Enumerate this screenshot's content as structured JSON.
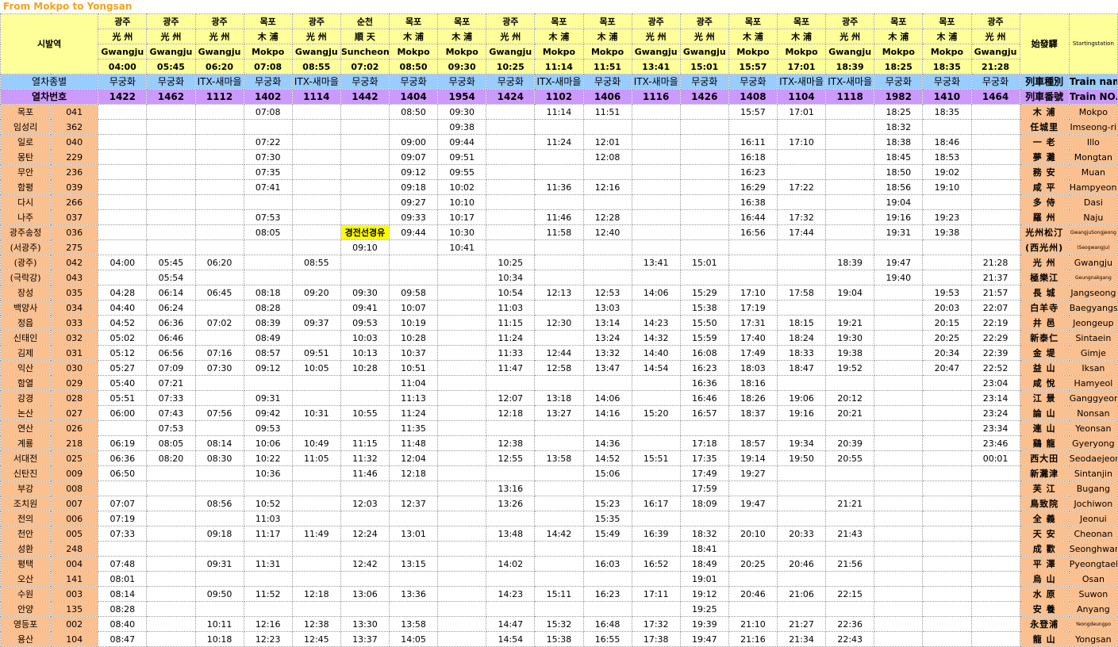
{
  "title": "From Mokpo to Yongsan",
  "header": {
    "origin_label": "시발역",
    "type_label": "열차종별",
    "number_label": "열차번호",
    "right_origin_hanja": "始發驛",
    "right_origin_en": "Startingstation",
    "right_type_hanja": "列車種別",
    "right_type_en": "Train name",
    "right_number_hanja": "列車番號",
    "right_number_en": "Train NO."
  },
  "trains": [
    {
      "ko": "광주",
      "hanja": "光 州",
      "en": "Gwangju",
      "time": "04:00",
      "type": "무궁화",
      "no": "1422"
    },
    {
      "ko": "광주",
      "hanja": "光 州",
      "en": "Gwangju",
      "time": "05:45",
      "type": "무궁화",
      "no": "1462"
    },
    {
      "ko": "광주",
      "hanja": "光 州",
      "en": "Gwangju",
      "time": "06:20",
      "type": "ITX-새마을",
      "no": "1112"
    },
    {
      "ko": "목포",
      "hanja": "木 浦",
      "en": "Mokpo",
      "time": "07:08",
      "type": "무궁화",
      "no": "1402"
    },
    {
      "ko": "광주",
      "hanja": "光 州",
      "en": "Gwangju",
      "time": "08:55",
      "type": "ITX-새마을",
      "no": "1114"
    },
    {
      "ko": "순천",
      "hanja": "順 天",
      "en": "Suncheon",
      "time": "07:02",
      "type": "무궁화",
      "no": "1442"
    },
    {
      "ko": "목포",
      "hanja": "木 浦",
      "en": "Mokpo",
      "time": "08:50",
      "type": "무궁화",
      "no": "1404"
    },
    {
      "ko": "목포",
      "hanja": "木 浦",
      "en": "Mokpo",
      "time": "09:30",
      "type": "무궁화",
      "no": "1954"
    },
    {
      "ko": "광주",
      "hanja": "光 州",
      "en": "Gwangju",
      "time": "10:25",
      "type": "무궁화",
      "no": "1424"
    },
    {
      "ko": "목포",
      "hanja": "木 浦",
      "en": "Mokpo",
      "time": "11:14",
      "type": "ITX-새마을",
      "no": "1102"
    },
    {
      "ko": "목포",
      "hanja": "木 浦",
      "en": "Mokpo",
      "time": "11:51",
      "type": "무궁화",
      "no": "1406"
    },
    {
      "ko": "광주",
      "hanja": "光 州",
      "en": "Gwangju",
      "time": "13:41",
      "type": "ITX-새마을",
      "no": "1116"
    },
    {
      "ko": "광주",
      "hanja": "光 州",
      "en": "Gwangju",
      "time": "15:01",
      "type": "무궁화",
      "no": "1426"
    },
    {
      "ko": "목포",
      "hanja": "木 浦",
      "en": "Mokpo",
      "time": "15:57",
      "type": "무궁화",
      "no": "1408"
    },
    {
      "ko": "목포",
      "hanja": "木 浦",
      "en": "Mokpo",
      "time": "17:01",
      "type": "ITX-새마을",
      "no": "1104"
    },
    {
      "ko": "광주",
      "hanja": "光 州",
      "en": "Gwangju",
      "time": "18:39",
      "type": "ITX-새마을",
      "no": "1118"
    },
    {
      "ko": "목포",
      "hanja": "木 浦",
      "en": "Mokpo",
      "time": "18:25",
      "type": "무궁화",
      "no": "1982"
    },
    {
      "ko": "목포",
      "hanja": "木 浦",
      "en": "Mokpo",
      "time": "18:35",
      "type": "무궁화",
      "no": "1410"
    },
    {
      "ko": "광주",
      "hanja": "光 州",
      "en": "Gwangju",
      "time": "21:28",
      "type": "무궁화",
      "no": "1464"
    }
  ],
  "stations": [
    {
      "ko": "목포",
      "code": "041",
      "hanja": "木 浦",
      "en": "Mokpo",
      "times": [
        "",
        "",
        "",
        "07:08",
        "",
        "",
        "08:50",
        "09:30",
        "",
        "11:14",
        "11:51",
        "",
        "",
        "15:57",
        "17:01",
        "",
        "18:25",
        "18:35",
        ""
      ]
    },
    {
      "ko": "임성리",
      "code": "362",
      "hanja": "任城里",
      "en": "Imseong-ri",
      "times": [
        "",
        "",
        "",
        "",
        "",
        "",
        "",
        "09:38",
        "",
        "",
        "",
        "",
        "",
        "",
        "",
        "",
        "18:32",
        "",
        ""
      ]
    },
    {
      "ko": "일로",
      "code": "040",
      "hanja": "一 老",
      "en": "Illo",
      "times": [
        "",
        "",
        "",
        "07:22",
        "",
        "",
        "09:00",
        "09:44",
        "",
        "11:24",
        "12:01",
        "",
        "",
        "16:11",
        "17:10",
        "",
        "18:38",
        "18:46",
        ""
      ]
    },
    {
      "ko": "몽탄",
      "code": "229",
      "hanja": "夢 灘",
      "en": "Mongtan",
      "times": [
        "",
        "",
        "",
        "07:30",
        "",
        "",
        "09:07",
        "09:51",
        "",
        "",
        "12:08",
        "",
        "",
        "16:18",
        "",
        "",
        "18:45",
        "18:53",
        ""
      ]
    },
    {
      "ko": "무안",
      "code": "236",
      "hanja": "務 安",
      "en": "Muan",
      "times": [
        "",
        "",
        "",
        "07:35",
        "",
        "",
        "09:12",
        "09:55",
        "",
        "",
        "",
        "",
        "",
        "16:23",
        "",
        "",
        "18:50",
        "19:02",
        ""
      ]
    },
    {
      "ko": "함평",
      "code": "039",
      "hanja": "咸 平",
      "en": "Hampyeong",
      "times": [
        "",
        "",
        "",
        "07:41",
        "",
        "",
        "09:18",
        "10:02",
        "",
        "11:36",
        "12:16",
        "",
        "",
        "16:29",
        "17:22",
        "",
        "18:56",
        "19:10",
        ""
      ]
    },
    {
      "ko": "다시",
      "code": "266",
      "hanja": "多 侍",
      "en": "Dasi",
      "times": [
        "",
        "",
        "",
        "",
        "",
        "",
        "09:27",
        "10:10",
        "",
        "",
        "",
        "",
        "",
        "16:38",
        "",
        "",
        "19:04",
        "",
        ""
      ]
    },
    {
      "ko": "나주",
      "code": "037",
      "hanja": "羅 州",
      "en": "Naju",
      "times": [
        "",
        "",
        "",
        "07:53",
        "",
        "",
        "09:33",
        "10:17",
        "",
        "11:46",
        "12:28",
        "",
        "",
        "16:44",
        "17:32",
        "",
        "19:16",
        "19:23",
        ""
      ]
    },
    {
      "ko": "광주송정",
      "code": "036",
      "hanja": "光州松汀",
      "en": "GwangjuSongjeong",
      "small": true,
      "times": [
        "",
        "",
        "",
        "08:05",
        "",
        "경전선경유",
        "09:44",
        "10:30",
        "",
        "11:58",
        "12:40",
        "",
        "",
        "16:56",
        "17:44",
        "",
        "19:31",
        "19:38",
        ""
      ]
    },
    {
      "ko": "(서광주)",
      "code": "275",
      "hanja": "(西光州)",
      "en": "(Seogwangju)",
      "small": true,
      "times": [
        "",
        "",
        "",
        "",
        "",
        "09:10",
        "",
        "10:41",
        "",
        "",
        "",
        "",
        "",
        "",
        "",
        "",
        "",
        "",
        ""
      ]
    },
    {
      "ko": "(광주)",
      "code": "042",
      "hanja": "光 州",
      "en": "Gwangju",
      "times": [
        "04:00",
        "05:45",
        "06:20",
        "",
        "08:55",
        "",
        "",
        "",
        "10:25",
        "",
        "",
        "13:41",
        "15:01",
        "",
        "",
        "18:39",
        "19:47",
        "",
        "21:28"
      ]
    },
    {
      "ko": "(극락강)",
      "code": "043",
      "hanja": "極樂江",
      "en": "Geungnakgang",
      "small": true,
      "times": [
        "",
        "05:54",
        "",
        "",
        "",
        "",
        "",
        "",
        "10:34",
        "",
        "",
        "",
        "",
        "",
        "",
        "",
        "19:40",
        "",
        "21:37"
      ]
    },
    {
      "ko": "장성",
      "code": "035",
      "hanja": "長 城",
      "en": "Jangseong",
      "times": [
        "04:28",
        "06:14",
        "06:45",
        "08:18",
        "09:20",
        "09:30",
        "09:58",
        "",
        "10:54",
        "12:13",
        "12:53",
        "14:06",
        "15:29",
        "17:10",
        "17:58",
        "19:04",
        "",
        "19:53",
        "21:57"
      ]
    },
    {
      "ko": "백양사",
      "code": "034",
      "hanja": "白羊寺",
      "en": "Baegyangsa",
      "times": [
        "04:40",
        "06:24",
        "",
        "08:28",
        "",
        "09:41",
        "10:07",
        "",
        "11:03",
        "",
        "13:03",
        "",
        "15:38",
        "17:19",
        "",
        "",
        "",
        "20:03",
        "22:07"
      ]
    },
    {
      "ko": "정읍",
      "code": "033",
      "hanja": "井 邑",
      "en": "Jeongeup",
      "times": [
        "04:52",
        "06:36",
        "07:02",
        "08:39",
        "09:37",
        "09:53",
        "10:19",
        "",
        "11:15",
        "12:30",
        "13:14",
        "14:23",
        "15:50",
        "17:31",
        "18:15",
        "19:21",
        "",
        "20:15",
        "22:19"
      ]
    },
    {
      "ko": "신태인",
      "code": "032",
      "hanja": "新泰仁",
      "en": "Sintaein",
      "times": [
        "05:02",
        "06:46",
        "",
        "08:49",
        "",
        "10:03",
        "10:28",
        "",
        "11:24",
        "",
        "13:24",
        "14:32",
        "15:59",
        "17:40",
        "18:24",
        "19:30",
        "",
        "20:25",
        "22:29"
      ]
    },
    {
      "ko": "김제",
      "code": "031",
      "hanja": "金 堤",
      "en": "Gimje",
      "times": [
        "05:12",
        "06:56",
        "07:16",
        "08:57",
        "09:51",
        "10:13",
        "10:37",
        "",
        "11:33",
        "12:44",
        "13:32",
        "14:40",
        "16:08",
        "17:49",
        "18:33",
        "19:38",
        "",
        "20:34",
        "22:39"
      ]
    },
    {
      "ko": "익산",
      "code": "030",
      "hanja": "益 山",
      "en": "Iksan",
      "times": [
        "05:27",
        "07:09",
        "07:30",
        "09:12",
        "10:05",
        "10:28",
        "10:51",
        "",
        "11:47",
        "12:58",
        "13:47",
        "14:54",
        "16:23",
        "18:03",
        "18:47",
        "19:52",
        "",
        "20:47",
        "22:52"
      ]
    },
    {
      "ko": "함열",
      "code": "029",
      "hanja": "咸 悅",
      "en": "Hamyeol",
      "times": [
        "05:40",
        "07:21",
        "",
        "",
        "",
        "",
        "11:04",
        "",
        "",
        "",
        "",
        "",
        "16:36",
        "18:16",
        "",
        "",
        "",
        "",
        "23:04"
      ]
    },
    {
      "ko": "강경",
      "code": "028",
      "hanja": "江 景",
      "en": "Ganggyeong",
      "times": [
        "05:51",
        "07:33",
        "",
        "09:31",
        "",
        "",
        "11:13",
        "",
        "12:07",
        "13:18",
        "14:06",
        "",
        "16:46",
        "18:26",
        "19:06",
        "20:12",
        "",
        "",
        "23:14"
      ]
    },
    {
      "ko": "논산",
      "code": "027",
      "hanja": "論 山",
      "en": "Nonsan",
      "times": [
        "06:00",
        "07:43",
        "07:56",
        "09:42",
        "10:31",
        "10:55",
        "11:24",
        "",
        "12:18",
        "13:27",
        "14:16",
        "15:20",
        "16:57",
        "18:37",
        "19:16",
        "20:21",
        "",
        "",
        "23:24"
      ]
    },
    {
      "ko": "연산",
      "code": "026",
      "hanja": "連 山",
      "en": "Yeonsan",
      "times": [
        "",
        "07:53",
        "",
        "09:53",
        "",
        "",
        "11:35",
        "",
        "",
        "",
        "",
        "",
        "",
        "",
        "",
        "",
        "",
        "",
        "23:34"
      ]
    },
    {
      "ko": "계룡",
      "code": "218",
      "hanja": "鷄 龍",
      "en": "Gyeryong",
      "times": [
        "06:19",
        "08:05",
        "08:14",
        "10:06",
        "10:49",
        "11:15",
        "11:48",
        "",
        "12:38",
        "",
        "14:36",
        "",
        "17:18",
        "18:57",
        "19:34",
        "20:39",
        "",
        "",
        "23:46"
      ]
    },
    {
      "ko": "서대전",
      "code": "025",
      "hanja": "西大田",
      "en": "Seodaejeon",
      "times": [
        "06:36",
        "08:20",
        "08:30",
        "10:22",
        "11:05",
        "11:32",
        "12:04",
        "",
        "12:55",
        "13:58",
        "14:52",
        "15:51",
        "17:35",
        "19:14",
        "19:50",
        "20:55",
        "",
        "",
        "00:01"
      ]
    },
    {
      "ko": "신탄진",
      "code": "009",
      "hanja": "新灘津",
      "en": "Sintanjin",
      "times": [
        "06:50",
        "",
        "",
        "10:36",
        "",
        "11:46",
        "12:18",
        "",
        "",
        "",
        "15:06",
        "",
        "17:49",
        "19:27",
        "",
        "",
        "",
        "",
        ""
      ]
    },
    {
      "ko": "부강",
      "code": "008",
      "hanja": "芙 江",
      "en": "Bugang",
      "times": [
        "",
        "",
        "",
        "",
        "",
        "",
        "",
        "",
        "13:16",
        "",
        "",
        "",
        "17:59",
        "",
        "",
        "",
        "",
        "",
        ""
      ]
    },
    {
      "ko": "조치원",
      "code": "007",
      "hanja": "鳥致院",
      "en": "Jochiwon",
      "times": [
        "07:07",
        "",
        "08:56",
        "10:52",
        "",
        "12:03",
        "12:37",
        "",
        "13:26",
        "",
        "15:23",
        "16:17",
        "18:09",
        "19:47",
        "",
        "21:21",
        "",
        "",
        ""
      ]
    },
    {
      "ko": "전의",
      "code": "006",
      "hanja": "全 義",
      "en": "Jeonui",
      "times": [
        "07:19",
        "",
        "",
        "11:03",
        "",
        "",
        "",
        "",
        "",
        "",
        "15:35",
        "",
        "",
        "",
        "",
        "",
        "",
        "",
        ""
      ]
    },
    {
      "ko": "천안",
      "code": "005",
      "hanja": "天 安",
      "en": "Cheonan",
      "times": [
        "07:33",
        "",
        "09:18",
        "11:17",
        "11:49",
        "12:24",
        "13:01",
        "",
        "13:48",
        "14:42",
        "15:49",
        "16:39",
        "18:32",
        "20:10",
        "20:33",
        "21:43",
        "",
        "",
        ""
      ]
    },
    {
      "ko": "성환",
      "code": "248",
      "hanja": "成 歡",
      "en": "Seonghwan",
      "times": [
        "",
        "",
        "",
        "",
        "",
        "",
        "",
        "",
        "",
        "",
        "",
        "",
        "18:41",
        "",
        "",
        "",
        "",
        "",
        ""
      ]
    },
    {
      "ko": "평택",
      "code": "004",
      "hanja": "平 澤",
      "en": "Pyeongtaek",
      "times": [
        "07:48",
        "",
        "09:31",
        "11:31",
        "",
        "12:42",
        "13:15",
        "",
        "14:02",
        "",
        "16:03",
        "16:52",
        "18:49",
        "20:25",
        "20:46",
        "21:56",
        "",
        "",
        ""
      ]
    },
    {
      "ko": "오산",
      "code": "141",
      "hanja": "烏 山",
      "en": "Osan",
      "times": [
        "08:01",
        "",
        "",
        "",
        "",
        "",
        "",
        "",
        "",
        "",
        "",
        "",
        "19:01",
        "",
        "",
        "",
        "",
        "",
        ""
      ]
    },
    {
      "ko": "수원",
      "code": "003",
      "hanja": "水 原",
      "en": "Suwon",
      "times": [
        "08:14",
        "",
        "09:50",
        "11:52",
        "12:18",
        "13:06",
        "13:36",
        "",
        "14:23",
        "15:11",
        "16:23",
        "17:11",
        "19:12",
        "20:46",
        "21:06",
        "22:15",
        "",
        "",
        ""
      ]
    },
    {
      "ko": "안양",
      "code": "135",
      "hanja": "安 養",
      "en": "Anyang",
      "times": [
        "08:28",
        "",
        "",
        "",
        "",
        "",
        "",
        "",
        "",
        "",
        "",
        "",
        "19:25",
        "",
        "",
        "",
        "",
        "",
        ""
      ]
    },
    {
      "ko": "영등포",
      "code": "002",
      "hanja": "永登浦",
      "en": "Yeongdeungpo",
      "small": true,
      "times": [
        "08:40",
        "",
        "10:11",
        "12:16",
        "12:38",
        "13:30",
        "13:58",
        "",
        "14:47",
        "15:32",
        "16:48",
        "17:32",
        "19:39",
        "21:10",
        "21:27",
        "22:36",
        "",
        "",
        ""
      ]
    },
    {
      "ko": "용산",
      "code": "104",
      "hanja": "龍 山",
      "en": "Yongsan",
      "times": [
        "08:47",
        "",
        "10:18",
        "12:23",
        "12:45",
        "13:37",
        "14:05",
        "",
        "14:54",
        "15:38",
        "16:55",
        "17:38",
        "19:47",
        "21:16",
        "21:34",
        "22:43",
        "",
        "",
        ""
      ]
    }
  ]
}
